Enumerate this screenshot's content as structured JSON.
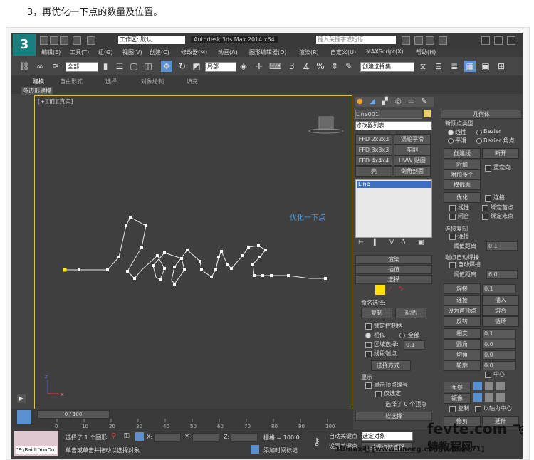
{
  "caption": "3，再优化一下点的数量及位置。",
  "title_bar": {
    "logo": "3",
    "workspace": "工作区: 默认",
    "app_title": "Autodesk 3ds Max  2014 x64",
    "search_placeholder": "键入关键字或短语"
  },
  "menu": [
    "编辑(E)",
    "工具(T)",
    "组(G)",
    "视图(V)",
    "创建(C)",
    "修改器(M)",
    "动画(A)",
    "图形编辑器(D)",
    "渲染(R)",
    "自定义(U)",
    "MAXScript(X)",
    "帮助(H)"
  ],
  "toolbar": {
    "filter": "全部",
    "coord": "局部",
    "selset": "创建选择集",
    "num1": "3",
    "num2": "%",
    "num3": "n"
  },
  "ribbon": {
    "tabs": [
      "建模",
      "自由形式",
      "选择",
      "对象绘制",
      "填充"
    ],
    "subtitle": "多边形建模"
  },
  "viewport": {
    "label": "[+][前][真实]",
    "annotation": "优化一下点",
    "colors": {
      "bg": "#3f3f3f",
      "spline": "#e8e8e8",
      "vertex": "#ffffff",
      "first": "#ffee00",
      "annotation": "#4a9de0"
    },
    "axis_z": "z",
    "axis_x": "x"
  },
  "cmd": {
    "object_name": "Line001",
    "modifier_list": "修改器列表",
    "mod_buttons": [
      "FFD 2x2x2",
      "涡轮平滑",
      "FFD 3x3x3",
      "车削",
      "FFD 4x4x4",
      "UVW 贴图",
      "壳",
      "倒角剖面"
    ],
    "stack_item": "Line",
    "roll_render": "渲染",
    "roll_interp": "插值",
    "roll_select": "选择",
    "named_sel": "命名选择:",
    "copy": "复制",
    "paste": "粘贴",
    "lock_handles": "锁定控制柄",
    "similar": "相似",
    "all": "全部",
    "area_sel": "区域选择:",
    "area_val": "0.1",
    "seg_end": "线段端点",
    "sel_method": "选择方式...",
    "display": "显示",
    "show_vnum": "显示顶点编号",
    "only_sel": "仅选定",
    "sel_status": "选择了 0 个顶点",
    "soft_sel": "软选择",
    "geometry": "几何体",
    "new_vtype": "新顶点类型",
    "linear": "线性",
    "bezier": "Bezier",
    "smooth": "平滑",
    "bezier_corner": "Bezier 角点",
    "create_line": "创建线",
    "break": "断开",
    "attach": "附加",
    "attach_multi": "附加多个",
    "reorient": "重定向",
    "cross_section": "横截面",
    "refine": "优化",
    "connect": "连接",
    "linear2": "线性",
    "bind_first": "绑定首点",
    "closed": "闭合",
    "bind_last": "绑定末点",
    "conn_copy": "连接复制",
    "connect2": "连接",
    "threshold": "阈值距离",
    "thresh_val": "0.1",
    "end_weld": "端点自动焊接",
    "auto_weld": "自动焊接",
    "threshold2": "阈值距离",
    "thresh_val2": "6.0",
    "weld": "焊接",
    "weld_val": "0.1",
    "connect3": "连接",
    "insert": "插入",
    "make_first": "设为首顶点",
    "fuse": "熔合",
    "reverse": "反转",
    "cycle": "循环",
    "cross_insert": "相交",
    "cross_val": "0.1",
    "fillet": "圆角",
    "fillet_val": "0.0",
    "chamfer": "切角",
    "chamfer_val": "0.0",
    "outline": "轮廓",
    "outline_val": "0.0",
    "center": "中心",
    "boolean": "布尔",
    "mirror": "镜像",
    "copy2": "复制",
    "about_pivot": "以轴为中心",
    "trim": "修剪",
    "extend": "延伸"
  },
  "timeline": {
    "frame": "0 / 100",
    "ticks": [
      "0",
      "10",
      "20",
      "30",
      "40",
      "50",
      "60",
      "70",
      "80",
      "90",
      "100"
    ]
  },
  "status": {
    "selected": "选择了 1 个图形",
    "hint": "单击或单击并拖动以选择对象",
    "x_label": "X:",
    "y_label": "Y:",
    "z_label": "Z:",
    "grid": "栅格 = 100.0",
    "auto_key": "自动关键点",
    "sel_obj": "选定对象",
    "set_key": "设置关键点",
    "key_filter": "关键点过滤器",
    "add_tag": "添加时间标记",
    "script_path": "\"E:\\BaiduYunDo"
  },
  "watermarks": {
    "wm1": "fevte.com",
    "wm1b": "飞特教程网",
    "wm2": "3Dmax吧 [www.linecg.com/tieba/171]"
  }
}
